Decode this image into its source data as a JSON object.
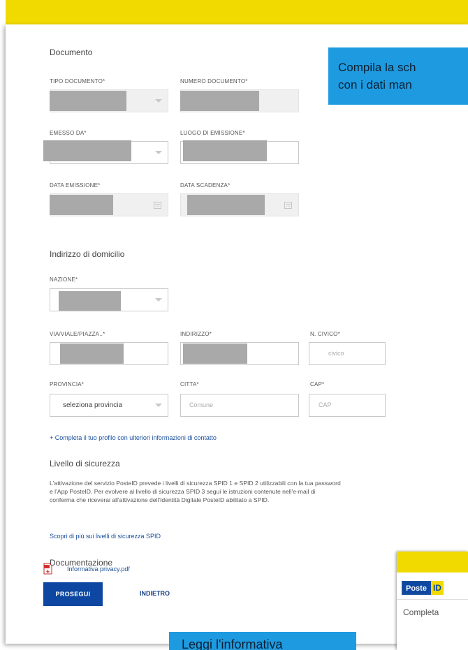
{
  "documento": {
    "title": "Documento",
    "tipo_label": "TIPO DOCUMENTO*",
    "numero_label": "NUMERO DOCUMENTO*",
    "emesso_label": "EMESSO DA*",
    "luogo_label": "LUOGO DI EMISSIONE*",
    "data_emissione_label": "DATA EMISSIONE*",
    "data_scadenza_label": "DATA SCADENZA*"
  },
  "indirizzo": {
    "title": "Indirizzo di domicilio",
    "nazione_label": "NAZIONE*",
    "via_label": "VIA/VIALE/PIAZZA..*",
    "indirizzo_label": "INDIRIZZO*",
    "civico_label": "N. CIVICO*",
    "civico_placeholder": "civico",
    "provincia_label": "PROVINCIA*",
    "provincia_value": "seleziona provincia",
    "citta_label": "CITTA*",
    "citta_placeholder": "Comune",
    "cap_label": "CAP*",
    "cap_placeholder": "CAP"
  },
  "completa_link": "+ Completa il tuo profilo con ulteriori informazioni di contatto",
  "sicurezza": {
    "title": "Livello di sicurezza",
    "paragraph_line1": "L'attivazione del servizio PosteID prevede i livelli di sicurezza SPID 1 e SPID 2 utilizzabili con la tua password",
    "paragraph_line2": "e l'App PosteID. Per evolvere al livello di sicurezza SPID 3 segui le istruzioni contenute nell'e-mail di",
    "paragraph_line3": "conferma che riceverai all'attivazione dell'Identità Digitale PosteID abilitato a SPID.",
    "link": "Scopri di più sui livelli di sicurezza SPID"
  },
  "documentazione": {
    "title": "Documentazione",
    "file": "Informativa privacy.pdf"
  },
  "buttons": {
    "prosegui": "PROSEGUI",
    "indietro": "INDIETRO"
  },
  "callout_top": {
    "line1": "Compila la sch",
    "line2": "con i dati man"
  },
  "callout_bottom": "Leggi l'informativa",
  "thumbnail": {
    "logo_text": "Poste",
    "logo_mark": "ID",
    "text": "Completa"
  },
  "colors": {
    "brand_yellow": "#f1da00",
    "brand_blue": "#0d47a1",
    "callout_blue": "#1e9be0",
    "redaction_gray": "#a9a9a9"
  }
}
